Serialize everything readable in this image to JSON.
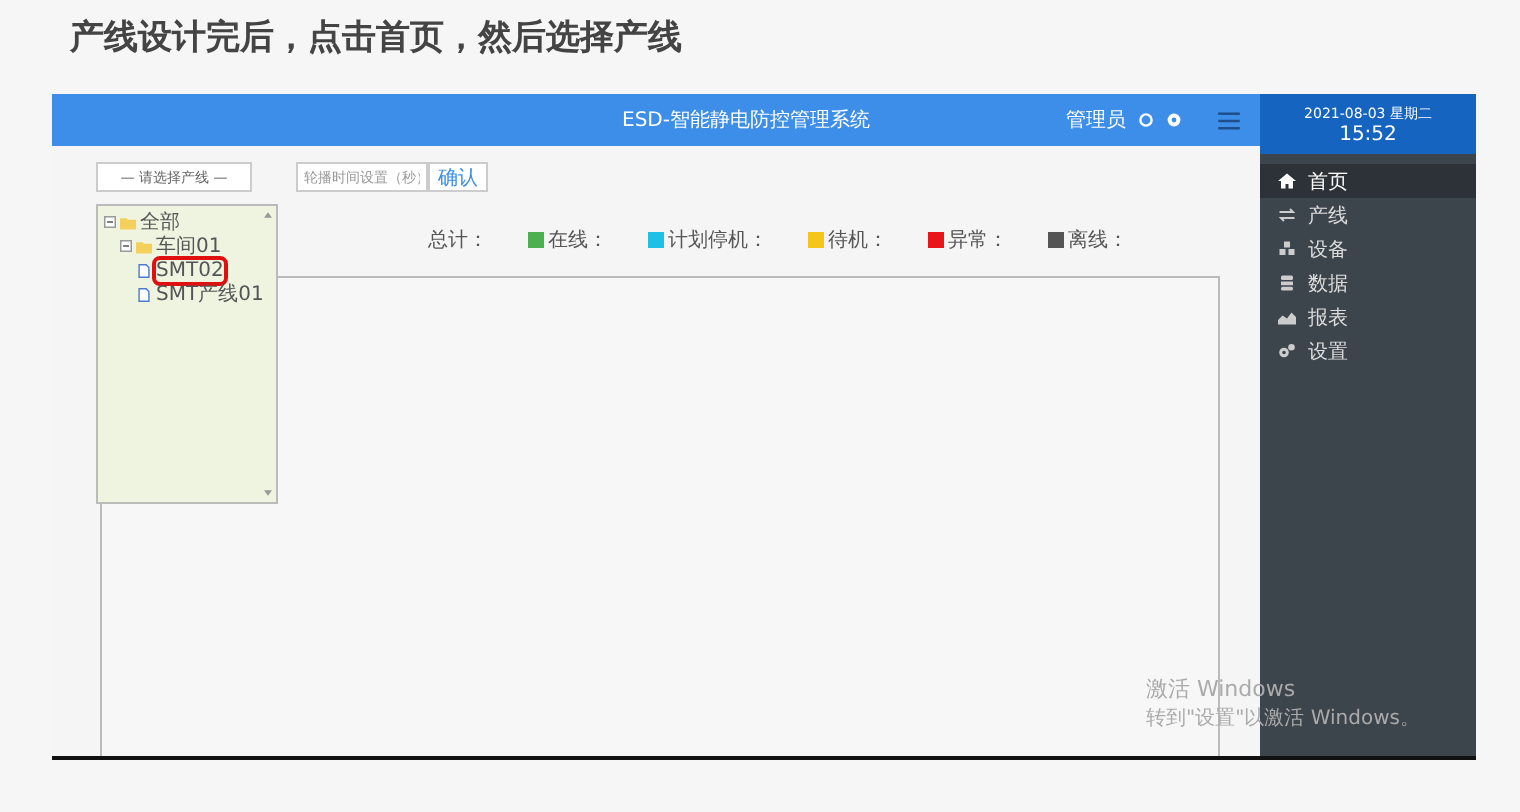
{
  "slide_title": "产线设计完后，点击首页，然后选择产线",
  "header": {
    "title": "ESD-智能静电防控管理系统",
    "user": "管理员",
    "date": "2021-08-03 星期二",
    "time": "15:52"
  },
  "controls": {
    "line_select": "— 请选择产线 —",
    "interval_placeholder": "轮播时间设置（秒）",
    "confirm": "确认"
  },
  "tree": [
    {
      "label": "全部",
      "kind": "folder",
      "expanded": true,
      "highlighted": false,
      "children": [
        {
          "label": "车间01",
          "kind": "folder",
          "expanded": true,
          "highlighted": false,
          "children": [
            {
              "label": "SMT02",
              "kind": "file",
              "highlighted": true
            },
            {
              "label": "SMT产线01",
              "kind": "file",
              "highlighted": false
            }
          ]
        }
      ]
    }
  ],
  "legend": [
    {
      "label": "总计："
    },
    {
      "label": "在线：",
      "color": "#4caf50"
    },
    {
      "label": "计划停机：",
      "color": "#1ec0e8"
    },
    {
      "label": "待机：",
      "color": "#f5c518"
    },
    {
      "label": "异常：",
      "color": "#e8161b"
    },
    {
      "label": "离线：",
      "color": "#555555"
    }
  ],
  "sidebar": [
    {
      "label": "首页",
      "kind": "home",
      "selected": true
    },
    {
      "label": "产线",
      "kind": "arrows",
      "selected": false
    },
    {
      "label": "设备",
      "kind": "cubes",
      "selected": false
    },
    {
      "label": "数据",
      "kind": "database",
      "selected": false
    },
    {
      "label": "报表",
      "kind": "chart",
      "selected": false
    },
    {
      "label": "设置",
      "kind": "gears",
      "selected": false
    }
  ],
  "os_notice": {
    "title": "激活 Windows",
    "message": "转到\"设置\"以激活 Windows。"
  }
}
